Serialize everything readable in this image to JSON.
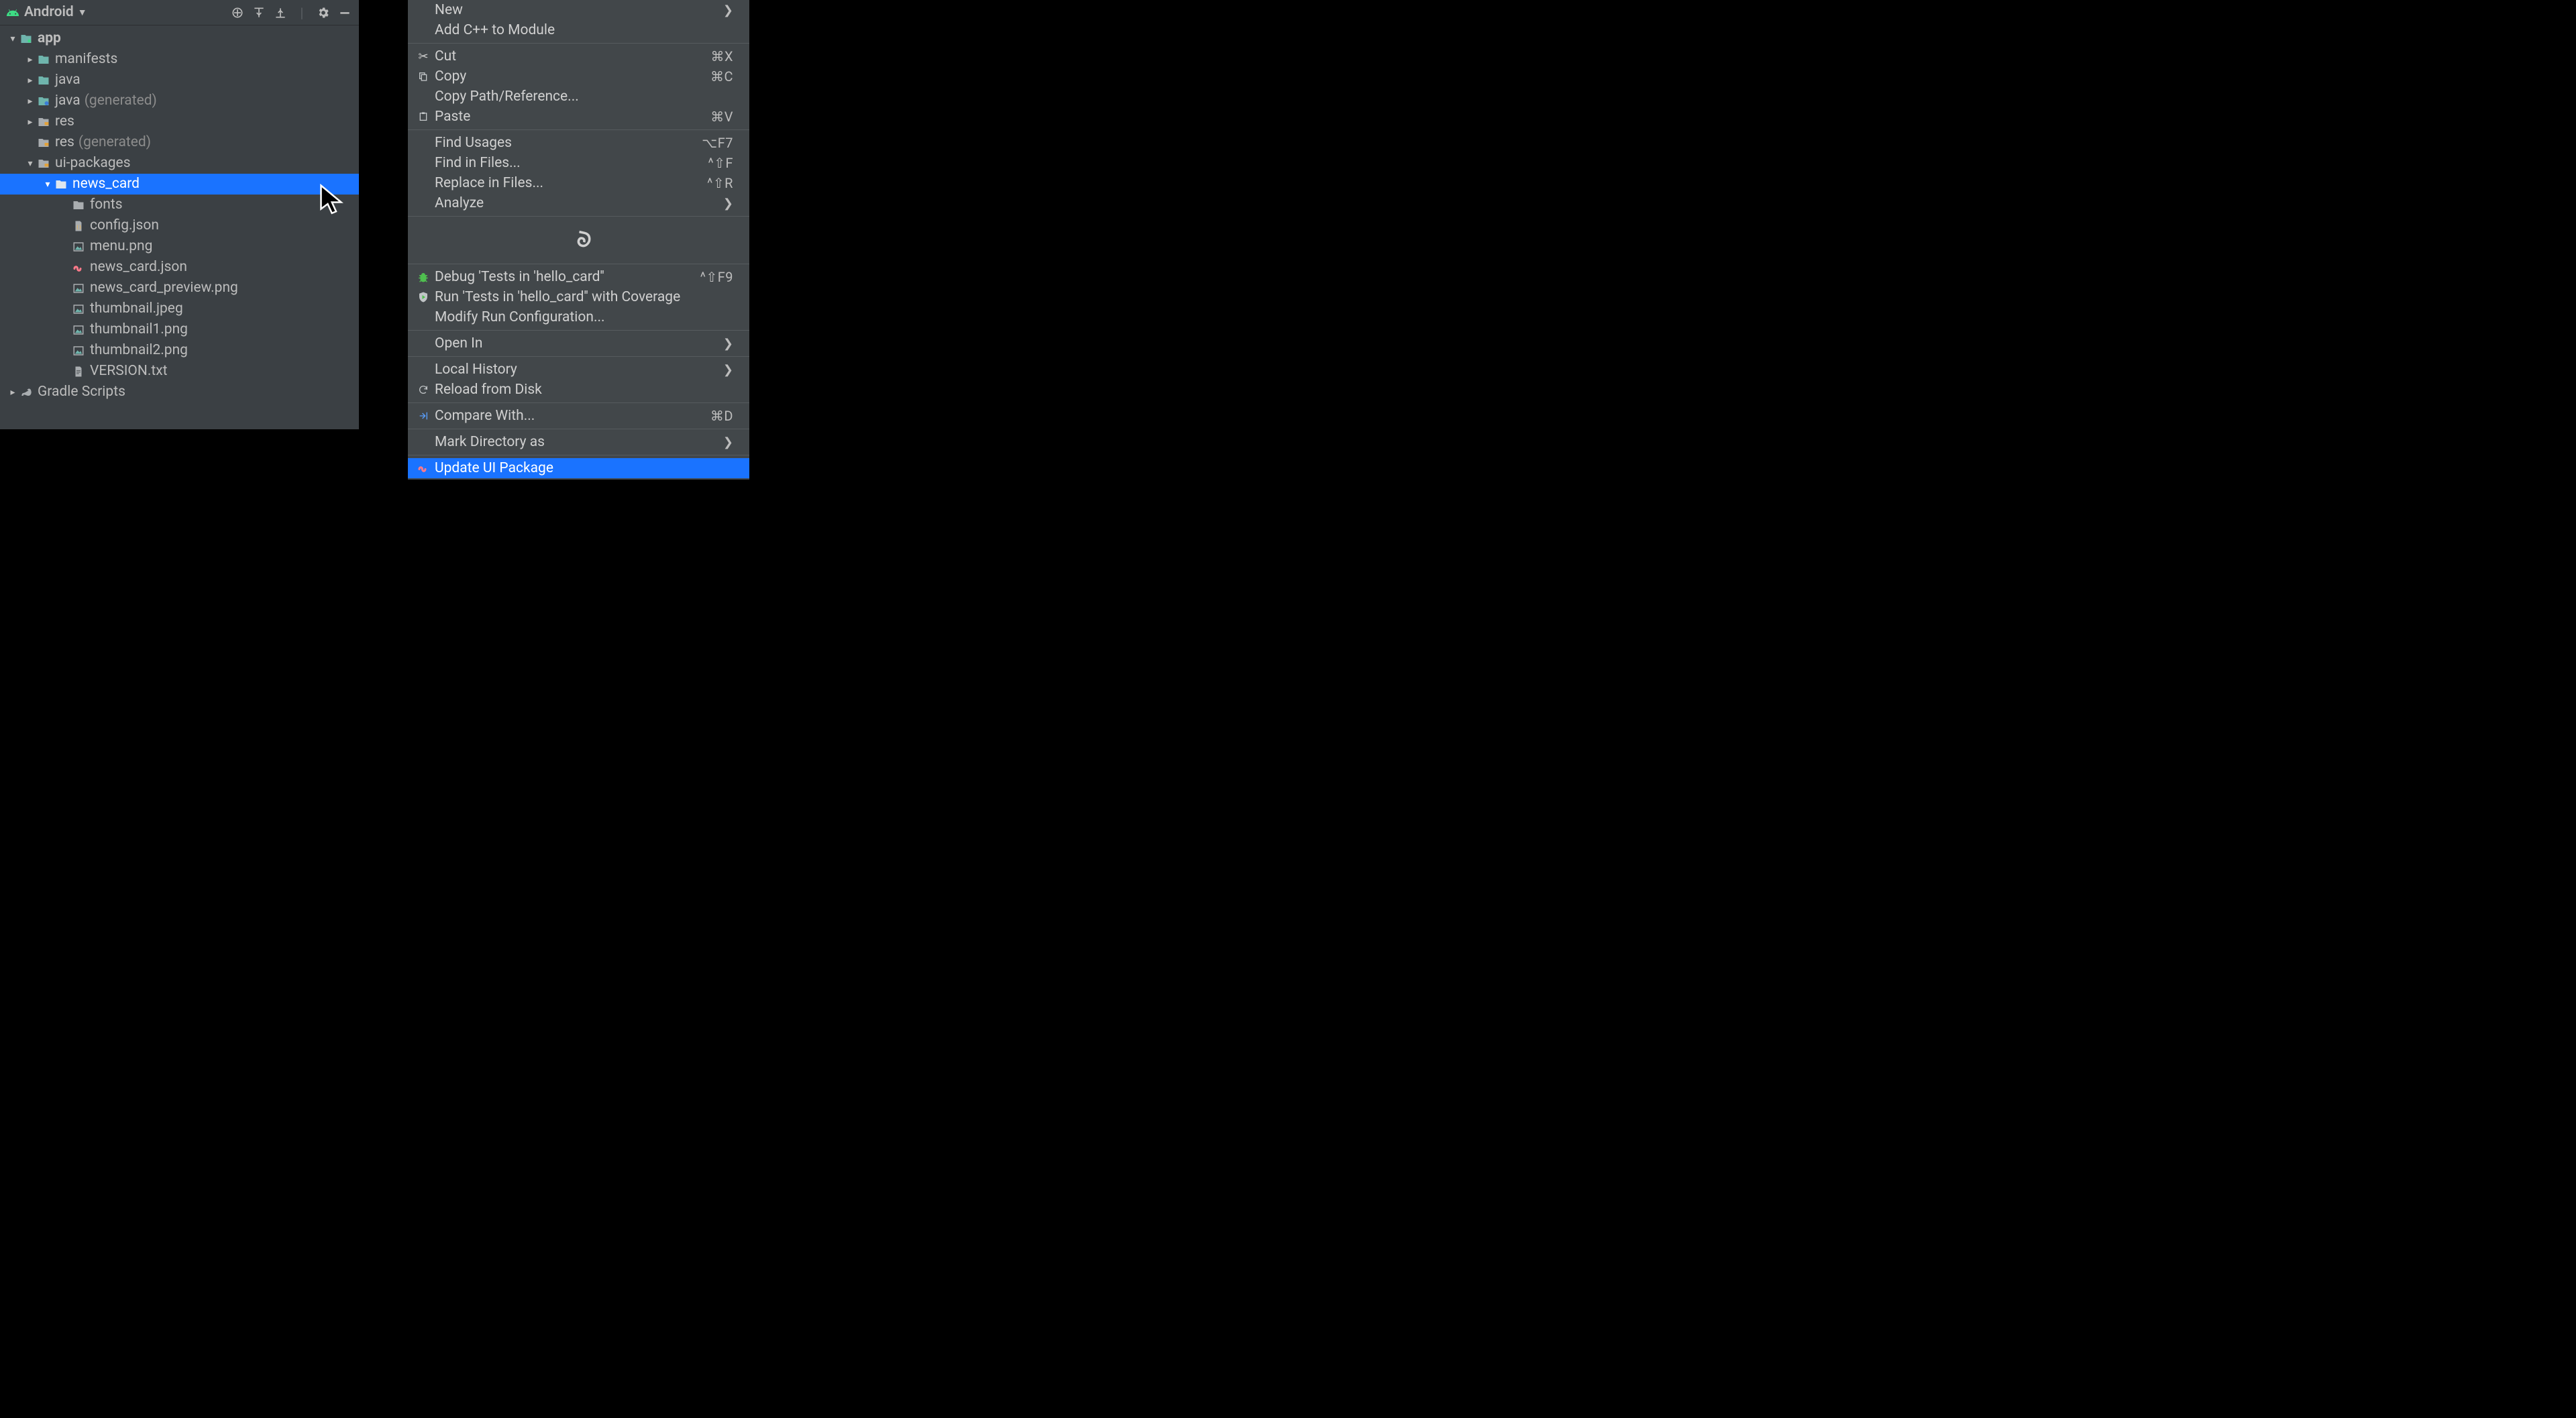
{
  "panel": {
    "title": "Android"
  },
  "tree": {
    "app": "app",
    "manifests": "manifests",
    "java": "java",
    "java_gen": "java",
    "java_gen_annot": "(generated)",
    "res": "res",
    "res_gen": "res",
    "res_gen_annot": "(generated)",
    "ui_packages": "ui-packages",
    "news_card": "news_card",
    "fonts": "fonts",
    "config_json": "config.json",
    "menu_png": "menu.png",
    "news_card_json": "news_card.json",
    "news_card_preview": "news_card_preview.png",
    "thumbnail_jpeg": "thumbnail.jpeg",
    "thumbnail1": "thumbnail1.png",
    "thumbnail2": "thumbnail2.png",
    "version_txt": "VERSION.txt",
    "gradle_scripts": "Gradle Scripts"
  },
  "menu": {
    "new": "New",
    "add_cpp": "Add C++ to Module",
    "cut": "Cut",
    "cut_s": "⌘X",
    "copy": "Copy",
    "copy_s": "⌘C",
    "copy_path": "Copy Path/Reference...",
    "paste": "Paste",
    "paste_s": "⌘V",
    "find_usages": "Find Usages",
    "find_usages_s": "⌥F7",
    "find_files": "Find in Files...",
    "find_files_s": "^⇧F",
    "replace_files": "Replace in Files...",
    "replace_files_s": "^⇧R",
    "analyze": "Analyze",
    "debug_tests": "Debug 'Tests in 'hello_card''",
    "debug_tests_s": "^⇧F9",
    "run_cov": "Run 'Tests in 'hello_card'' with Coverage",
    "modify_run": "Modify Run Configuration...",
    "open_in": "Open In",
    "local_history": "Local History",
    "reload": "Reload from Disk",
    "compare": "Compare With...",
    "compare_s": "⌘D",
    "mark_dir": "Mark Directory as",
    "update_ui": "Update UI Package"
  }
}
